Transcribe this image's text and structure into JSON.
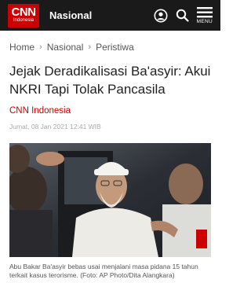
{
  "header": {
    "logo_big": "CNN",
    "logo_small": "Indonesia",
    "section": "Nasional",
    "menu_label": "MENU"
  },
  "breadcrumb": [
    "Home",
    "Nasional",
    "Peristiwa"
  ],
  "article": {
    "title": "Jejak Deradikalisasi Ba'asyir: Akui NKRI Tapi Tolak Pancasila",
    "source": "CNN Indonesia",
    "date": "Jumat, 08 Jan 2021 12:41 WIB",
    "caption": "Abu Bakar Ba'asyir bebas usai menjalani masa pidana 15 tahun terkait kasus terorisme. (Foto: AP Photo/Dita Alangkara)"
  },
  "icons": {
    "account": "user-circle-icon",
    "search": "search-icon",
    "menu": "hamburger-menu-icon"
  },
  "colors": {
    "brand_red": "#cc0000",
    "topbar": "#1a1a1a"
  }
}
